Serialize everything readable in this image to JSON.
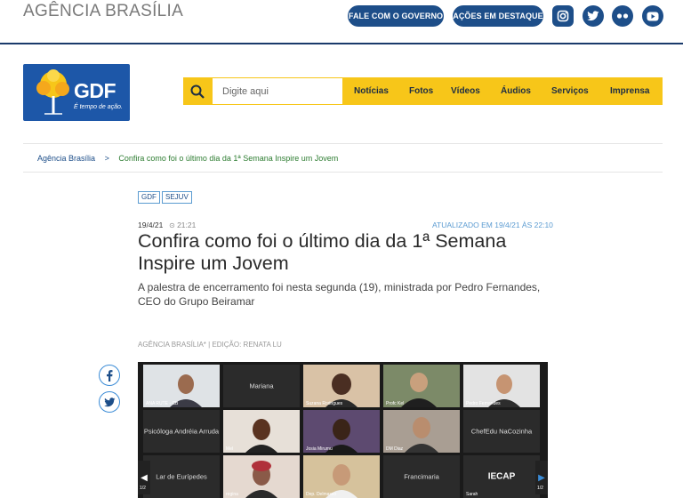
{
  "topbar": {
    "site_name": "AGÊNCIA BRASÍLIA",
    "fale_label": "FALE COM O GOVERNO",
    "acoes_label": "AÇÕES EM DESTAQUE",
    "socials": [
      "instagram-icon",
      "twitter-icon",
      "flickr-icon",
      "youtube-icon"
    ]
  },
  "logo": {
    "name": "GDF",
    "tagline": "É tempo de ação."
  },
  "search": {
    "placeholder": "Digite aqui"
  },
  "nav": {
    "items": [
      "Notícias",
      "Fotos",
      "Vídeos",
      "Áudios",
      "Serviços",
      "Imprensa"
    ]
  },
  "breadcrumb": {
    "home": "Agência Brasília",
    "sep": ">",
    "current": "Confira como foi o último dia da 1ª Semana Inspire um Jovem"
  },
  "article": {
    "tags": [
      "GDF",
      "SEJUV"
    ],
    "date": "19/4/21",
    "time": "21:21",
    "updated": "ATUALIZADO EM 19/4/21 ÀS 22:10",
    "title": "Confira como foi o último dia da 1ª Semana Inspire um Jovem",
    "lede": "A palestra de encerramento foi nesta segunda (19), ministrada por Pedro Fernandes, CEO do Grupo Beiramar",
    "byline": "AGÊNCIA BRASÍLIA* | EDIÇÃO: RENATA LU"
  },
  "video": {
    "tiles": [
      {
        "name": "",
        "label": "ANA RUTE - CB"
      },
      {
        "name": "Mariana",
        "label": ""
      },
      {
        "name": "",
        "label": "Suzana Rodrigues"
      },
      {
        "name": "",
        "label": "Profc Kel"
      },
      {
        "name": "",
        "label": "Pedro Fernandes"
      },
      {
        "name": "Psicóloga Andréia Arruda",
        "label": ""
      },
      {
        "name": "",
        "label": "Mel"
      },
      {
        "name": "",
        "label": "Josia Mirumu"
      },
      {
        "name": "",
        "label": "DM Diaz"
      },
      {
        "name": "ChefEdu NaCozinha",
        "label": ""
      },
      {
        "name": "Lar de Eurípedes",
        "label": ""
      },
      {
        "name": "",
        "label": "regina"
      },
      {
        "name": "",
        "label": "Dep. Delmasso"
      },
      {
        "name": "Francimaria",
        "label": ""
      },
      {
        "name": "IECAP",
        "label": "Sarah"
      }
    ],
    "page_left": "1/2",
    "page_right": "1/2"
  },
  "colors": {
    "navy": "#1d4e89",
    "yellow": "#f7c619",
    "green": "#2e7d32"
  }
}
